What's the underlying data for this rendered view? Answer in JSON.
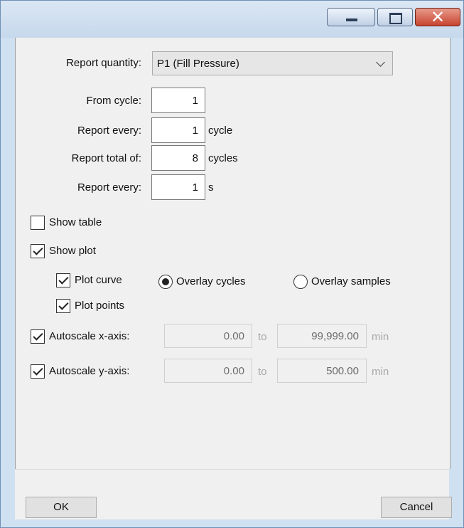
{
  "report_quantity": {
    "label": "Report quantity:",
    "selected": "P1 (Fill Pressure)"
  },
  "fields": [
    {
      "label": "From cycle:",
      "value": "1",
      "unit": ""
    },
    {
      "label": "Report every:",
      "value": "1",
      "unit": "cycle"
    },
    {
      "label": "Report total of:",
      "value": "8",
      "unit": "cycles"
    },
    {
      "label": "Report every:",
      "value": "1",
      "unit": "s"
    }
  ],
  "show_table": {
    "label": "Show table",
    "checked": false
  },
  "show_plot": {
    "label": "Show plot",
    "checked": true
  },
  "plot_curve": {
    "label": "Plot curve",
    "checked": true
  },
  "plot_points": {
    "label": "Plot points",
    "checked": true
  },
  "overlay": {
    "cycles_label": "Overlay cycles",
    "samples_label": "Overlay samples",
    "selected": "cycles"
  },
  "autoscale_x": {
    "label": "Autoscale x-axis:",
    "checked": true,
    "from": "0.00",
    "to_word": "to",
    "to": "99,999.00",
    "unit": "min"
  },
  "autoscale_y": {
    "label": "Autoscale y-axis:",
    "checked": true,
    "from": "0.00",
    "to_word": "to",
    "to": "500.00",
    "unit": "min"
  },
  "buttons": {
    "ok": "OK",
    "cancel": "Cancel"
  }
}
